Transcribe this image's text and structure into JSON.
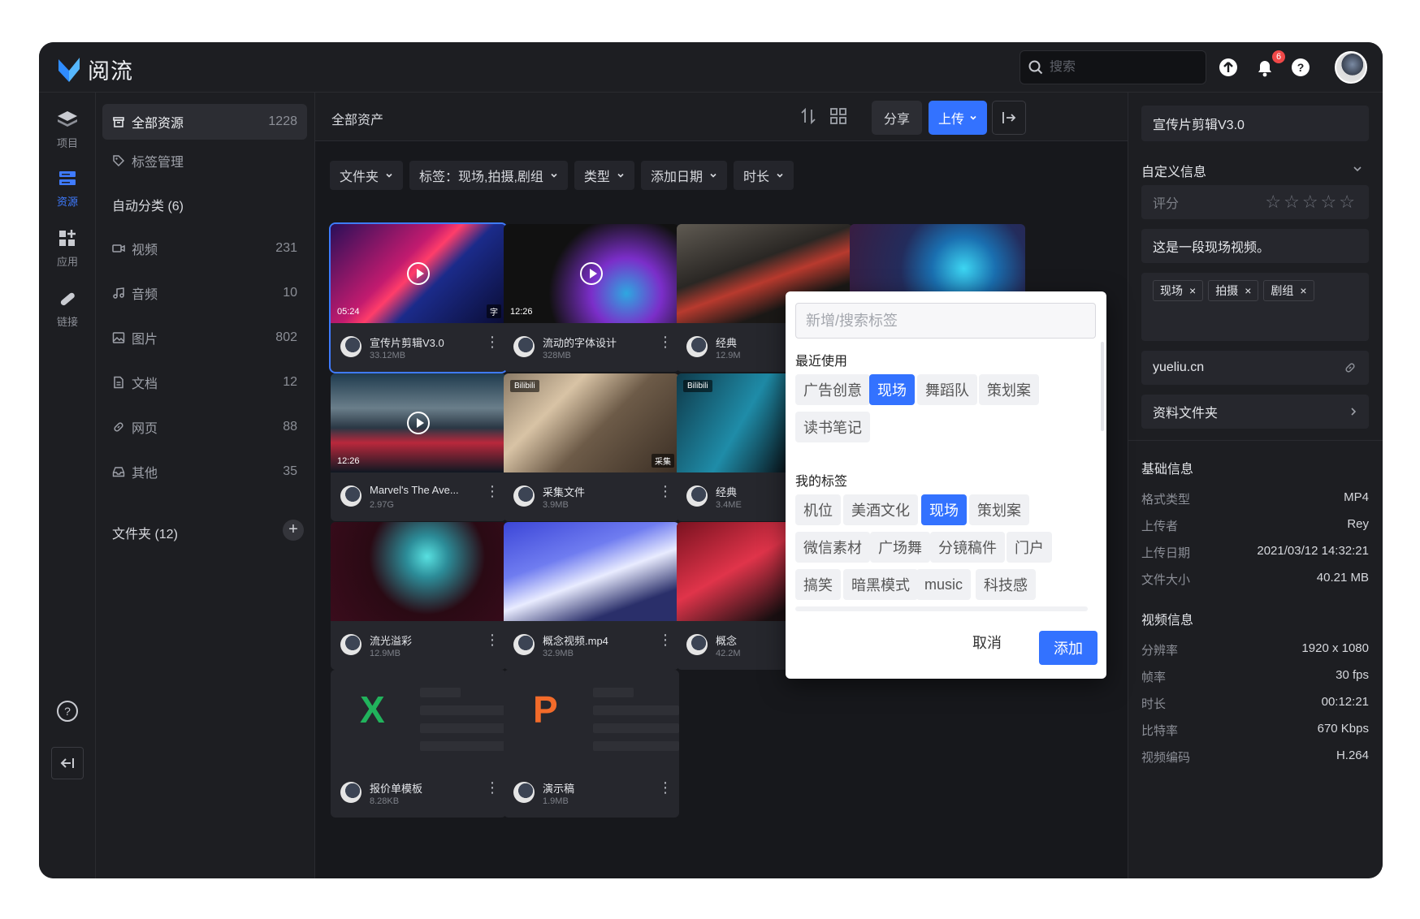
{
  "app": {
    "name": "阅流",
    "search_placeholder": "搜索",
    "notif_count": "6"
  },
  "rail": [
    {
      "label": "项目",
      "icon": "layers-icon"
    },
    {
      "label": "资源",
      "icon": "resource-icon"
    },
    {
      "label": "应用",
      "icon": "apps-icon"
    },
    {
      "label": "链接",
      "icon": "link-icon"
    }
  ],
  "sidebar": {
    "all": {
      "label": "全部资源",
      "count": "1228"
    },
    "tags": "标签管理",
    "auto_head": "自动分类 (6)",
    "items": [
      {
        "label": "视频",
        "count": "231"
      },
      {
        "label": "音频",
        "count": "10"
      },
      {
        "label": "图片",
        "count": "802"
      },
      {
        "label": "文档",
        "count": "12"
      },
      {
        "label": "网页",
        "count": "88"
      },
      {
        "label": "其他",
        "count": "35"
      }
    ],
    "folder_head": "文件夹 (12)"
  },
  "main": {
    "title": "全部资产",
    "share": "分享",
    "upload": "上传",
    "filters": [
      "文件夹",
      "标签：现场,拍摄,剧组",
      "类型",
      "添加日期",
      "时长"
    ]
  },
  "cards": [
    {
      "name": "宣传片剪辑V3.0",
      "size": "33.12MB",
      "dur": "05:24",
      "tag": "",
      "src": ""
    },
    {
      "name": "流动的字体设计",
      "size": "328MB",
      "dur": "12:26",
      "tag": "",
      "src": ""
    },
    {
      "name": "经典",
      "size": "12.9M",
      "dur": "",
      "tag": "采集",
      "src": ""
    },
    {
      "name": "Marvel's The Ave...",
      "size": "2.97G",
      "dur": "12:26",
      "tag": "",
      "src": ""
    },
    {
      "name": "采集文件",
      "size": "3.9MB",
      "dur": "",
      "tag": "采集",
      "src": "Bilibili"
    },
    {
      "name": "经典",
      "size": "3.4ME",
      "dur": "",
      "tag": "",
      "src": "Bilibili"
    },
    {
      "name": "流光溢彩",
      "size": "12.9MB",
      "dur": "",
      "tag": "",
      "src": ""
    },
    {
      "name": "概念视频.mp4",
      "size": "32.9MB",
      "dur": "",
      "tag": "",
      "src": ""
    },
    {
      "name": "概念",
      "size": "42.2M",
      "dur": "",
      "tag": "",
      "src": ""
    },
    {
      "name": "报价单模板",
      "size": "8.28KB",
      "letter": "X"
    },
    {
      "name": "演示稿",
      "size": "1.9MB",
      "letter": "P"
    }
  ],
  "popup": {
    "placeholder": "新增/搜索标签",
    "recent_head": "最近使用",
    "recent": [
      "广告创意",
      "现场",
      "舞蹈队",
      "策划案",
      "读书笔记"
    ],
    "mine_head": "我的标签",
    "mine": [
      "机位",
      "美酒文化",
      "现场",
      "策划案",
      "微信素材",
      "广场舞",
      "分镜稿件",
      "门户",
      "搞笑",
      "暗黑模式",
      "music",
      "科技感"
    ],
    "cancel": "取消",
    "add": "添加"
  },
  "right": {
    "title": "宣传片剪辑V3.0",
    "custom_head": "自定义信息",
    "rating_label": "评分",
    "description": "这是一段现场视频。",
    "tags": [
      "现场",
      "拍摄",
      "剧组"
    ],
    "url": "yueliu.cn",
    "folder": "资料文件夹",
    "basic_head": "基础信息",
    "basic": [
      {
        "k": "格式类型",
        "v": "MP4"
      },
      {
        "k": "上传者",
        "v": "Rey"
      },
      {
        "k": "上传日期",
        "v": "2021/03/12 14:32:21"
      },
      {
        "k": "文件大小",
        "v": "40.21 MB"
      }
    ],
    "video_head": "视频信息",
    "video": [
      {
        "k": "分辨率",
        "v": "1920 x 1080"
      },
      {
        "k": "帧率",
        "v": "30 fps"
      },
      {
        "k": "时长",
        "v": "00:12:21"
      },
      {
        "k": "比特率",
        "v": "670 Kbps"
      },
      {
        "k": "视频编码",
        "v": "H.264"
      }
    ]
  },
  "colors": {
    "accent": "#3372ff",
    "bg": "#17181c",
    "panel": "#1d1e22"
  }
}
